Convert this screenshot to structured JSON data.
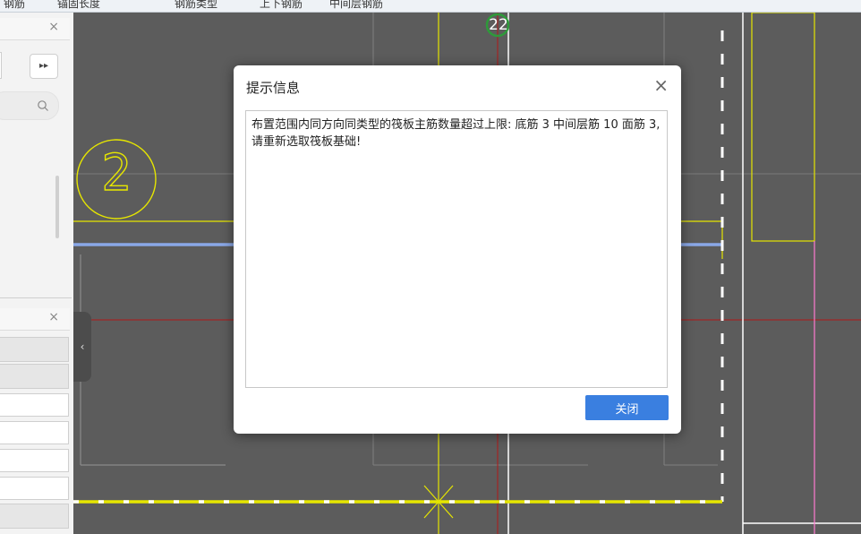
{
  "toolbar": {
    "item1": "钢筋",
    "item2": "锚固长度",
    "item3": "钢筋类型",
    "radio1": "上下钢筋",
    "radio2": "中间层钢筋"
  },
  "left_panel": {
    "more_label": "▸▸",
    "close_glyph": "×"
  },
  "drawing": {
    "axis_label_top": "22",
    "axis_label_left": "2",
    "colors": {
      "background": "#5c5c5c",
      "yellow": "#e6e600",
      "blue_beam": "#8aa8e8",
      "red_axis": "#b01818",
      "pink": "#ff7ad0",
      "white": "#ffffff"
    }
  },
  "dialog": {
    "title": "提示信息",
    "close_glyph": "×",
    "message": "布置范围内同方向同类型的筏板主筋数量超过上限: 底筋 3 中间层筋 10 面筋 3, 请重新选取筏板基础!",
    "button_label": "关闭"
  }
}
